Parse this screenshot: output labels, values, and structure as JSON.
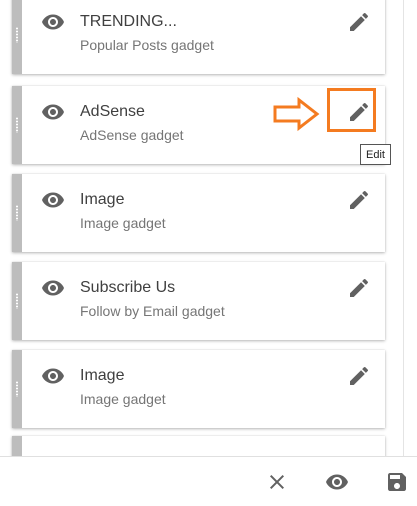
{
  "gadgets": [
    {
      "title": "TRENDING...",
      "subtitle": "Popular Posts gadget",
      "visibility_icon": "eye-icon",
      "edit_icon": "pencil-icon"
    },
    {
      "title": "AdSense",
      "subtitle": "AdSense gadget",
      "visibility_icon": "eye-icon",
      "edit_icon": "pencil-icon"
    },
    {
      "title": "Image",
      "subtitle": "Image gadget",
      "visibility_icon": "eye-icon",
      "edit_icon": "pencil-icon"
    },
    {
      "title": "Subscribe Us",
      "subtitle": "Follow by Email gadget",
      "visibility_icon": "eye-icon",
      "edit_icon": "pencil-icon"
    },
    {
      "title": "Image",
      "subtitle": "Image gadget",
      "visibility_icon": "eye-icon",
      "edit_icon": "pencil-icon"
    }
  ],
  "tooltip": {
    "text": "Edit"
  },
  "annotation": {
    "color": "#f47b20",
    "shape": "arrow-and-box"
  },
  "bottom_bar": {
    "buttons": [
      {
        "icon": "close-icon"
      },
      {
        "icon": "eye-icon"
      },
      {
        "icon": "save-icon"
      }
    ]
  },
  "colors": {
    "handle": "#bdbdbd",
    "icon": "#616161",
    "title": "#404040",
    "subtitle": "#757575",
    "annotation": "#f47b20"
  }
}
